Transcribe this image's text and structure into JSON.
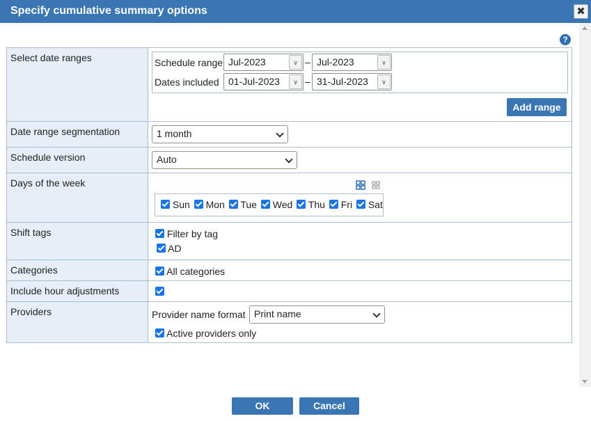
{
  "dialog": {
    "title": "Specify cumulative summary options",
    "close_glyph": "✖",
    "help_glyph": "?"
  },
  "date_ranges": {
    "label": "Select date ranges",
    "schedule_range_label": "Schedule range",
    "schedule_from": "Jul-2023",
    "schedule_to": "Jul-2023",
    "dates_included_label": "Dates included",
    "dates_from": "01-Jul-2023",
    "dates_to": "31-Jul-2023",
    "separator": "–",
    "add_range_label": "Add range"
  },
  "segmentation": {
    "label": "Date range segmentation",
    "value": "1 month"
  },
  "schedule_version": {
    "label": "Schedule version",
    "value": "Auto"
  },
  "days": {
    "label": "Days of the week",
    "items": [
      "Sun",
      "Mon",
      "Tue",
      "Wed",
      "Thu",
      "Fri",
      "Sat"
    ]
  },
  "shift_tags": {
    "label": "Shift tags",
    "filter_label": "Filter by tag",
    "tag": "AD"
  },
  "categories": {
    "label": "Categories",
    "all_label": "All categories"
  },
  "hour_adjustments": {
    "label": "Include hour adjustments"
  },
  "providers": {
    "label": "Providers",
    "format_label": "Provider name format",
    "format_value": "Print name",
    "active_only_label": "Active providers only"
  },
  "footer": {
    "ok_label": "OK",
    "cancel_label": "Cancel"
  },
  "colors": {
    "accent": "#3a76b4",
    "label_bg": "#e8eef7",
    "border": "#a9bcd6",
    "checkbox": "#1a73e8"
  }
}
